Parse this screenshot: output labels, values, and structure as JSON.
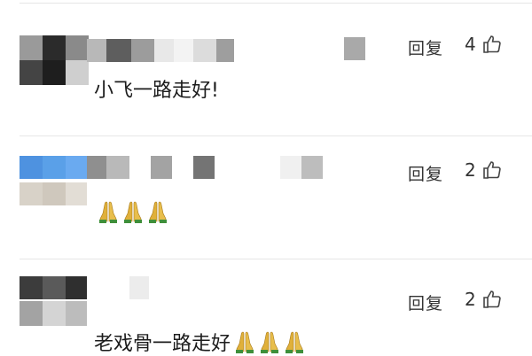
{
  "comments": [
    {
      "text": "小飞一路走好!",
      "reply_label": "回复",
      "like_count": "4",
      "emoji": "",
      "emoji_count": 0
    },
    {
      "text": "",
      "reply_label": "回复",
      "like_count": "2",
      "emoji": "folded-hands",
      "emoji_count": 3
    },
    {
      "text": "老戏骨一路走好",
      "reply_label": "回复",
      "like_count": "2",
      "emoji": "folded-hands",
      "emoji_count": 3
    }
  ],
  "colors": {
    "text": "#1c1c1c",
    "muted": "#333333",
    "divider": "#e6e6e6",
    "avatar_blue": "#5aa0e8",
    "pray_gold": "#e0b03a",
    "pray_green": "#3f8f3a"
  }
}
